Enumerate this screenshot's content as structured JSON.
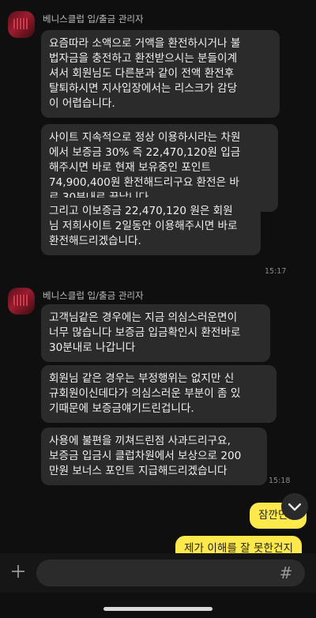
{
  "groups": [
    {
      "sender": "베니스클럽 입/출금 관리자",
      "messages": [
        "요즘따라 소액으로 거액을 환전하시거나 불\n법자금을 충전하고 환전받으시는 분들이계\n셔서 회원님도 다른분과 같이 전액 환전후\n탈퇴하시면 지사입장에서는 리스크가 감당\n이 어렵습니다.",
        "사이트 지속적으로 정상 이용하시라는 차원\n에서 보증금 30% 즉 22,470,120원 입금\n해주시면 바로 현재 보유중인 포인트\n74,900,400원 환전해드리구요 환전은 바\n로 30분내로 끝납니다",
        "그리고 이보증금  22,470,120 원은 회원\n님 저희사이트 2일동안 이용해주시면 바로\n환전해드리겠습니다."
      ],
      "time": "15:17"
    },
    {
      "sender": "베니스클럽 입/출금 관리자",
      "messages": [
        "고객님같은 경우에는 지금 의심스러운면이\n너무 많습니다 보증금 입금확인시 환전바로\n30분내로 나갑니다",
        "회원님 같은 경우는 부정행위는 없지만 신\n규회원이신데다가 의심스러운 부분이 좀 있\n기때문에 보증금얘기드린겁니다.",
        "사용에 불편을 끼쳐드린점 사과드리구요,\n보증금 입금시 클럽차원에서 보상으로 200\n만원 보너스 포인트 지급해드리겠습니다"
      ],
      "time": "15:18"
    }
  ],
  "my_messages": [
    "잠깐만요",
    "제가 이해를 잘 못한건지"
  ],
  "icons": {
    "scroll_down": "chevron-down-icon",
    "attach": "plus-icon",
    "hash": "hash-icon"
  },
  "input": {
    "hash_symbol": "#"
  },
  "colors": {
    "my_bubble": "#fde94b",
    "their_bubble": "#2b2b2b",
    "background": "#0f0f0f"
  }
}
